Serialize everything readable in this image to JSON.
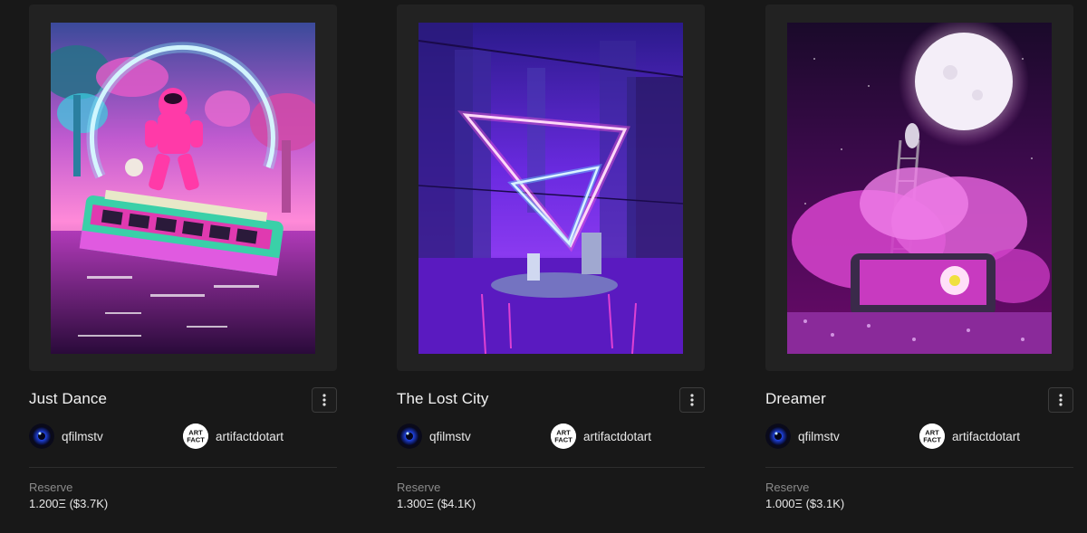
{
  "cards": [
    {
      "title": "Just Dance",
      "artwork_icon": "dancing-figure-on-bus-artwork",
      "creator": {
        "handle": "qfilmstv",
        "avatar_icon": "blue-eye-avatar"
      },
      "owner": {
        "handle": "artifactdotart",
        "avatar_icon": "artfact-logo-avatar",
        "avatar_text": [
          "ART",
          "FACT"
        ]
      },
      "reserve_label": "Reserve",
      "reserve_value": "1.200Ξ ($3.7K)"
    },
    {
      "title": "The Lost City",
      "artwork_icon": "neon-triangles-city-artwork",
      "creator": {
        "handle": "qfilmstv",
        "avatar_icon": "blue-eye-avatar"
      },
      "owner": {
        "handle": "artifactdotart",
        "avatar_icon": "artfact-logo-avatar",
        "avatar_text": [
          "ART",
          "FACT"
        ]
      },
      "reserve_label": "Reserve",
      "reserve_value": "1.300Ξ ($4.1K)"
    },
    {
      "title": "Dreamer",
      "artwork_icon": "moon-ladder-van-artwork",
      "creator": {
        "handle": "qfilmstv",
        "avatar_icon": "blue-eye-avatar"
      },
      "owner": {
        "handle": "artifactdotart",
        "avatar_icon": "artfact-logo-avatar",
        "avatar_text": [
          "ART",
          "FACT"
        ]
      },
      "reserve_label": "Reserve",
      "reserve_value": "1.000Ξ ($3.1K)"
    }
  ],
  "menu_icon": "more-vertical-icon",
  "colors": {
    "page_background": "#181818",
    "card_frame": "#222222",
    "muted_text": "#8a8a8a"
  }
}
